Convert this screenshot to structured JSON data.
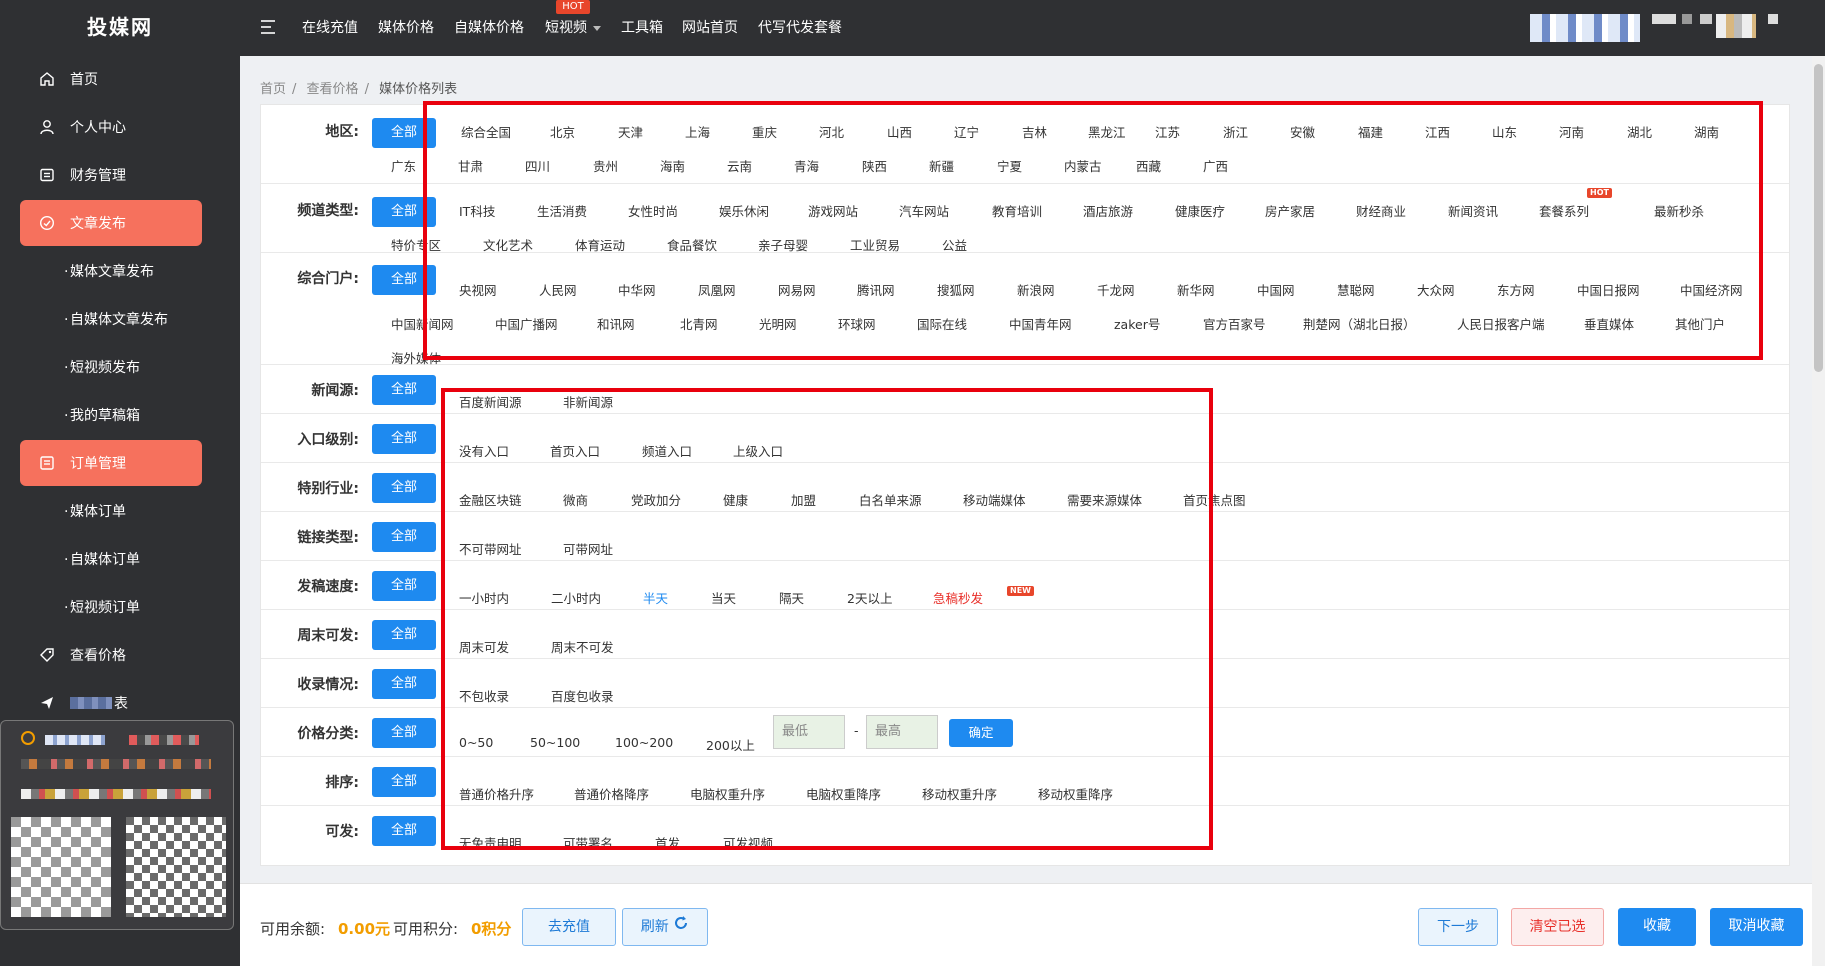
{
  "app": {
    "logo": "投媒网"
  },
  "colors": {
    "sidebar_bg": "#2f3033",
    "accent_active": "#f6715d",
    "primary": "#1e8af0",
    "highlight_box": "#e9000d",
    "price_orange": "#f29d00",
    "danger": "#e8302a"
  },
  "sidebar": {
    "items": [
      {
        "label": "首页",
        "icon": "home-icon"
      },
      {
        "label": "个人中心",
        "icon": "user-icon"
      },
      {
        "label": "财务管理",
        "icon": "wallet-icon"
      },
      {
        "label": "文章发布",
        "icon": "send-icon",
        "active": true
      },
      {
        "label": "订单管理",
        "icon": "list-icon",
        "active": true
      },
      {
        "label": "查看价格",
        "icon": "tag-icon"
      }
    ],
    "article_subitems": [
      "媒体文章发布",
      "自媒体文章发布",
      "短视频发布",
      "我的草稿箱"
    ],
    "order_subitems": [
      "媒体订单",
      "自媒体订单",
      "短视频订单"
    ],
    "obscured_item_suffix": "表"
  },
  "header": {
    "nav": [
      "在线充值",
      "媒体价格",
      "自媒体价格",
      "短视频",
      "工具箱",
      "网站首页",
      "代写代发套餐"
    ],
    "hot_badge": "HOT"
  },
  "breadcrumb": [
    "首页",
    "查看价格",
    "媒体价格列表"
  ],
  "filters": {
    "all_label": "全部",
    "region": {
      "label": "地区:",
      "options": [
        "综合全国",
        "北京",
        "天津",
        "上海",
        "重庆",
        "河北",
        "山西",
        "辽宁",
        "吉林",
        "黑龙江",
        "江苏",
        "浙江",
        "安徽",
        "福建",
        "江西",
        "山东",
        "河南",
        "湖北",
        "湖南",
        "广东",
        "甘肃",
        "四川",
        "贵州",
        "海南",
        "云南",
        "青海",
        "陕西",
        "新疆",
        "宁夏",
        "内蒙古",
        "西藏",
        "广西"
      ]
    },
    "channel": {
      "label": "频道类型:",
      "options": [
        "IT科技",
        "生活消费",
        "女性时尚",
        "娱乐休闲",
        "游戏网站",
        "汽车网站",
        "教育培训",
        "酒店旅游",
        "健康医疗",
        "房产家居",
        "财经商业",
        "新闻资讯",
        "套餐系列",
        "最新秒杀",
        "特价专区",
        "文化艺术",
        "体育运动",
        "食品餐饮",
        "亲子母婴",
        "工业贸易",
        "公益"
      ],
      "hot_badge": "HOT"
    },
    "portal": {
      "label": "综合门户:",
      "options": [
        "央视网",
        "人民网",
        "中华网",
        "凤凰网",
        "网易网",
        "腾讯网",
        "搜狐网",
        "新浪网",
        "千龙网",
        "新华网",
        "中国网",
        "慧聪网",
        "大众网",
        "东方网",
        "中国日报网",
        "中国经济网",
        "中国新闻网",
        "中国广播网",
        "和讯网",
        "北青网",
        "光明网",
        "环球网",
        "国际在线",
        "中国青年网",
        "zaker号",
        "官方百家号",
        "荆楚网（湖北日报）",
        "人民日报客户端",
        "垂直媒体",
        "其他门户",
        "海外媒体"
      ]
    },
    "news_source": {
      "label": "新闻源:",
      "options": [
        "百度新闻源",
        "非新闻源"
      ]
    },
    "entry_level": {
      "label": "入口级别:",
      "options": [
        "没有入口",
        "首页入口",
        "频道入口",
        "上级入口"
      ]
    },
    "special": {
      "label": "特别行业:",
      "options": [
        "金融区块链",
        "微商",
        "党政加分",
        "健康",
        "加盟",
        "白名单来源",
        "移动端媒体",
        "需要来源媒体",
        "首页焦点图"
      ]
    },
    "link_type": {
      "label": "链接类型:",
      "options": [
        "不可带网址",
        "可带网址"
      ]
    },
    "speed": {
      "label": "发稿速度:",
      "options": [
        "一小时内",
        "二小时内",
        "半天",
        "当天",
        "隔天",
        "2天以上",
        "急稿秒发"
      ],
      "new_badge": "NEW"
    },
    "weekend": {
      "label": "周末可发:",
      "options": [
        "周末可发",
        "周末不可发"
      ]
    },
    "indexing": {
      "label": "收录情况:",
      "options": [
        "不包收录",
        "百度包收录"
      ]
    },
    "price": {
      "label": "价格分类:",
      "options": [
        "0~50",
        "50~100",
        "100~200",
        "200以上"
      ],
      "min_placeholder": "最低",
      "separator": "-",
      "max_placeholder": "最高",
      "confirm": "确定"
    },
    "sort": {
      "label": "排序:",
      "options": [
        "普通价格升序",
        "普通价格降序",
        "电脑权重升序",
        "电脑权重降序",
        "移动权重升序",
        "移动权重降序"
      ]
    },
    "publish": {
      "label": "可发:",
      "options": [
        "无免责申明",
        "可带署名",
        "首发",
        "可发视频"
      ]
    }
  },
  "bottom": {
    "balance_label": "可用余额:",
    "balance_value": "0.00元",
    "points_label": "可用积分:",
    "points_value": "0积分",
    "recharge": "去充值",
    "refresh": "刷新",
    "next": "下一步",
    "clear": "清空已选",
    "favorite": "收藏",
    "unfavorite": "取消收藏"
  }
}
